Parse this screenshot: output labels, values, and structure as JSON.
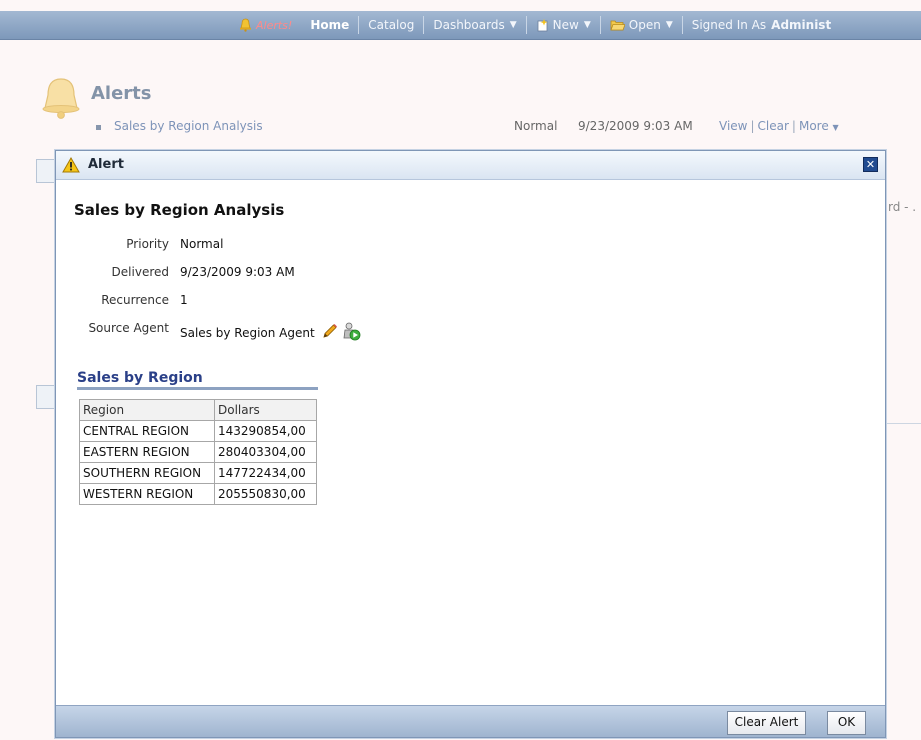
{
  "topbar": {
    "alerts_label": "Alerts!",
    "home": "Home",
    "catalog": "Catalog",
    "dashboards": "Dashboards",
    "new": "New",
    "open": "Open",
    "signed_in_label": "Signed In As",
    "user": "Administ"
  },
  "page": {
    "title": "Alerts",
    "alert": {
      "name": "Sales by Region Analysis",
      "priority": "Normal",
      "date": "9/23/2009 9:03 AM",
      "view": "View",
      "clear": "Clear",
      "more": "More"
    },
    "bg_truncated": "rd - ."
  },
  "dialog": {
    "title": "Alert",
    "analysis_title": "Sales by Region Analysis",
    "props": {
      "priority_label": "Priority",
      "priority_value": "Normal",
      "delivered_label": "Delivered",
      "delivered_value": "9/23/2009 9:03 AM",
      "recurrence_label": "Recurrence",
      "recurrence_value": "1",
      "source_label": "Source Agent",
      "source_value": "Sales by Region Agent"
    },
    "section_title": "Sales by Region",
    "table": {
      "columns": [
        "Region",
        "Dollars"
      ],
      "rows": [
        [
          "CENTRAL REGION",
          "143290854,00"
        ],
        [
          "EASTERN REGION",
          "280403304,00"
        ],
        [
          "SOUTHERN REGION",
          "147722434,00"
        ],
        [
          "WESTERN REGION",
          "205550830,00"
        ]
      ]
    },
    "buttons": {
      "clear_alert": "Clear Alert",
      "ok": "OK"
    }
  },
  "icons": {
    "bell": "bell-icon",
    "warning": "warning-icon",
    "close": "close-icon",
    "edit": "pencil-icon",
    "run_agent": "run-agent-icon"
  },
  "colors": {
    "topbar": "#8ea6c6",
    "link": "#7d93b8",
    "section_title": "#2b4088",
    "alerts_highlight": "#ff8a8a"
  }
}
